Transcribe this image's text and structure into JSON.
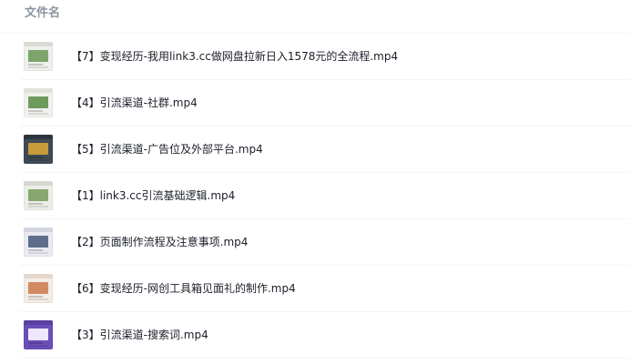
{
  "header": {
    "column_label": "文件名"
  },
  "files": [
    {
      "name": "【7】变现经历-我用link3.cc做网盘拉新日入1578元的全流程.mp4",
      "thumb_icon": "video-thumbnail-icon",
      "thumb_colors": {
        "bg": "#eef0ec",
        "bar": "#d9dcd4",
        "block": "#7da56b"
      }
    },
    {
      "name": "【4】引流渠道-社群.mp4",
      "thumb_icon": "video-thumbnail-icon",
      "thumb_colors": {
        "bg": "#f1f2ee",
        "bar": "#e0e2da",
        "block": "#6f9a5e"
      }
    },
    {
      "name": "【5】引流渠道-广告位及外部平台.mp4",
      "thumb_icon": "video-thumbnail-icon",
      "thumb_colors": {
        "bg": "#3f4a55",
        "bar": "#2d353e",
        "block": "#c79a3a"
      }
    },
    {
      "name": "【1】link3.cc引流基础逻辑.mp4",
      "thumb_icon": "video-thumbnail-icon",
      "thumb_colors": {
        "bg": "#eceee8",
        "bar": "#d5d8cf",
        "block": "#86a870"
      }
    },
    {
      "name": "【2】页面制作流程及注意事项.mp4",
      "thumb_icon": "video-thumbnail-icon",
      "thumb_colors": {
        "bg": "#e9ebf1",
        "bar": "#d3d6df",
        "block": "#5e6d8c"
      }
    },
    {
      "name": "【6】变现经历-网创工具箱见面礼的制作.mp4",
      "thumb_icon": "video-thumbnail-icon",
      "thumb_colors": {
        "bg": "#f3ece7",
        "bar": "#e4d7cd",
        "block": "#d28a63"
      }
    },
    {
      "name": "【3】引流渠道-搜索词.mp4",
      "thumb_icon": "video-thumbnail-icon",
      "thumb_colors": {
        "bg": "#6b4fb8",
        "bar": "#5a3fa4",
        "block": "#efe6ff"
      }
    }
  ]
}
